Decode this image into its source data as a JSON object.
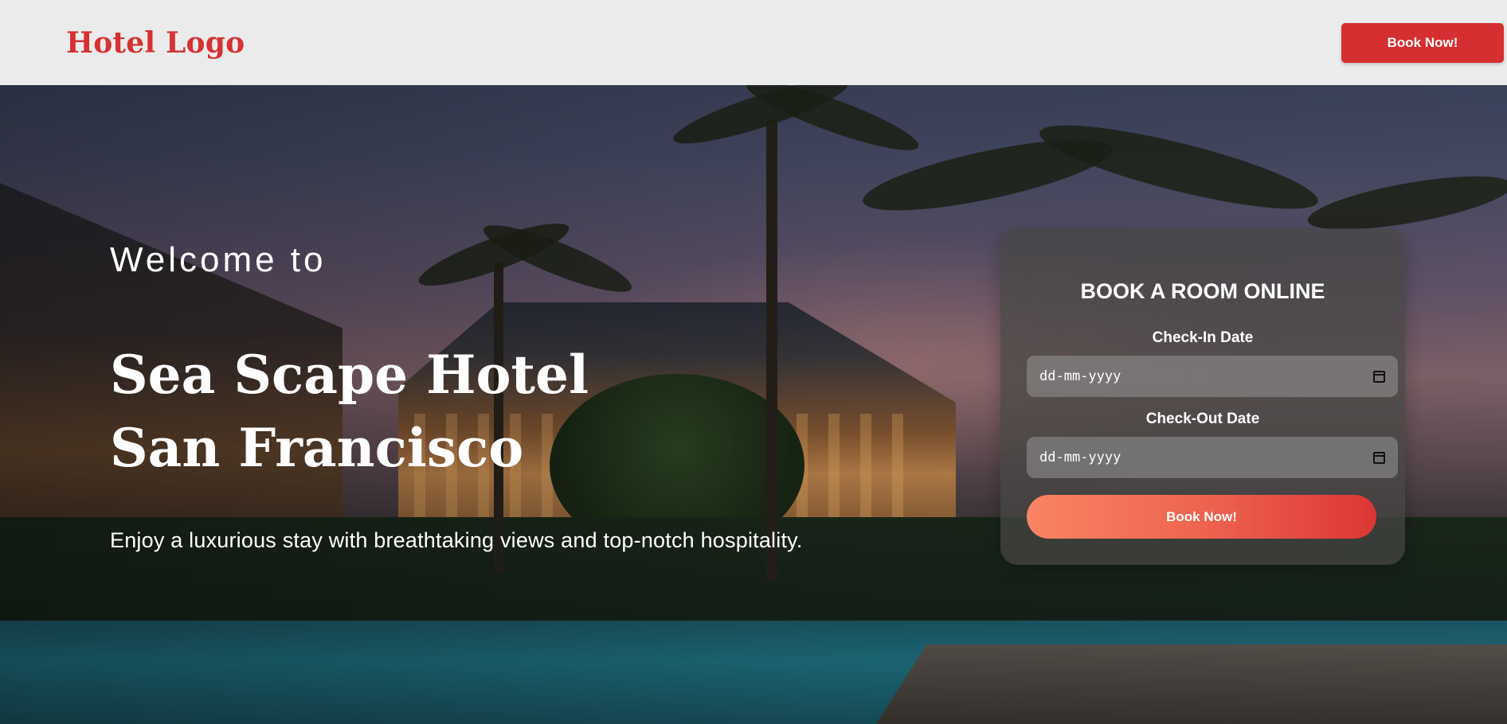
{
  "header": {
    "logo": "Hotel Logo",
    "cta_label": "Book Now!"
  },
  "hero": {
    "welcome": "Welcome to",
    "title_line1": "Sea Scape Hotel",
    "title_line2": "San Francisco",
    "tagline": "Enjoy a luxurious stay with breathtaking views and top-notch hospitality."
  },
  "booking": {
    "title": "BOOK A ROOM ONLINE",
    "checkin_label": "Check-In Date",
    "checkin_placeholder": "dd-mm-yyyy",
    "checkout_label": "Check-Out Date",
    "checkout_placeholder": "dd-mm-yyyy",
    "submit_label": "Book Now!"
  },
  "colors": {
    "brand_red": "#d62f31",
    "button_gradient_start": "#f98463",
    "button_gradient_end": "#dc3636"
  },
  "icons": {
    "date_picker": "calendar-icon"
  }
}
